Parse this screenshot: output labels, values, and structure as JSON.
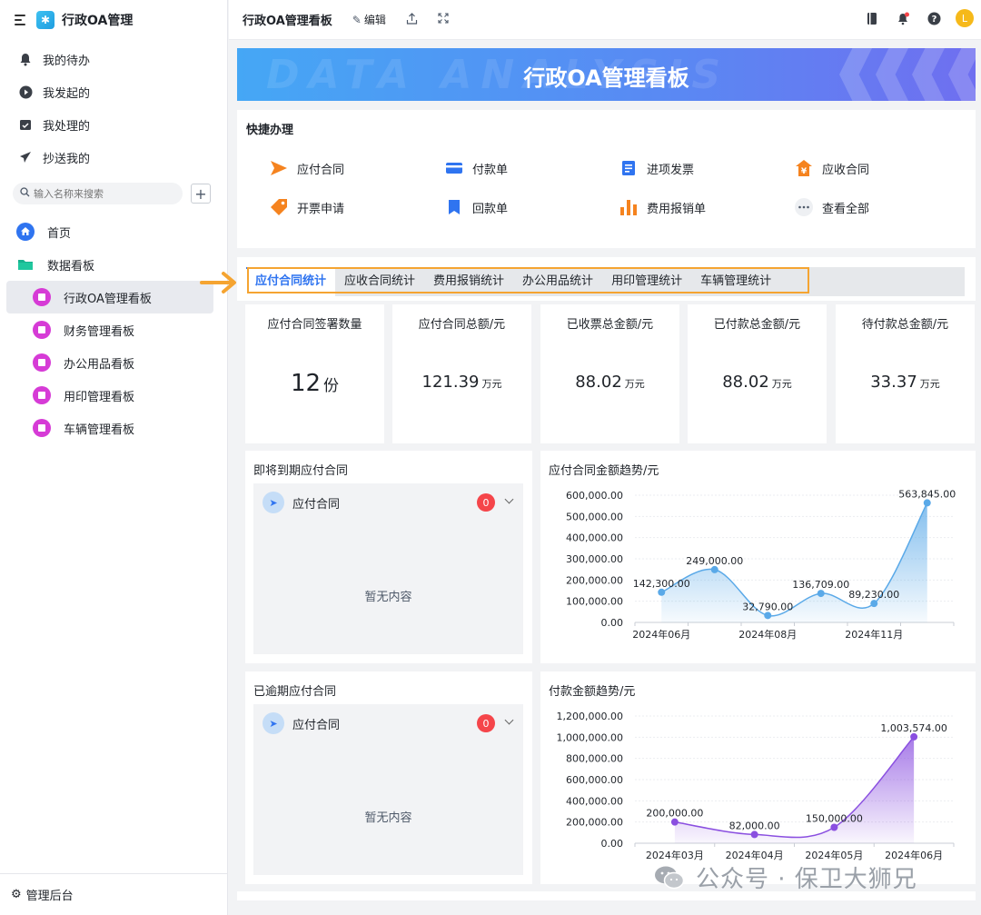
{
  "sidebar": {
    "app_title": "行政OA管理",
    "nav": [
      {
        "label": "我的待办",
        "icon": "bell-icon"
      },
      {
        "label": "我发起的",
        "icon": "play-circle-icon"
      },
      {
        "label": "我处理的",
        "icon": "calendar-check-icon"
      },
      {
        "label": "抄送我的",
        "icon": "send-icon"
      }
    ],
    "search_placeholder": "输入名称来搜索",
    "add_label": "+",
    "tree": [
      {
        "label": "首页",
        "icon": "home-icon"
      },
      {
        "label": "数据看板",
        "icon": "folder-icon"
      }
    ],
    "boards": [
      {
        "label": "行政OA管理看板",
        "icon": "dashboard-icon",
        "active": true
      },
      {
        "label": "财务管理看板",
        "icon": "finance-icon",
        "active": false
      },
      {
        "label": "办公用品看板",
        "icon": "box-icon",
        "active": false
      },
      {
        "label": "用印管理看板",
        "icon": "stamp-icon",
        "active": false
      },
      {
        "label": "车辆管理看板",
        "icon": "truck-icon",
        "active": false
      }
    ],
    "footer_label": "管理后台"
  },
  "topbar": {
    "title": "行政OA管理看板",
    "edit_label": "编辑",
    "avatar_letter": "L"
  },
  "banner": {
    "title": "行政OA管理看板",
    "bg_text": "DATA ANALYSIS"
  },
  "quick": {
    "title": "快捷办理",
    "items": [
      {
        "label": "应付合同",
        "icon": "send-icon",
        "color": "#f5831f"
      },
      {
        "label": "付款单",
        "icon": "card-icon",
        "color": "#2f74f0"
      },
      {
        "label": "进项发票",
        "icon": "document-icon",
        "color": "#2f74f0"
      },
      {
        "label": "应收合同",
        "icon": "yuan-house-icon",
        "color": "#f5831f"
      },
      {
        "label": "开票申请",
        "icon": "tag-icon",
        "color": "#f5831f"
      },
      {
        "label": "回款单",
        "icon": "bookmark-icon",
        "color": "#2f74f0"
      },
      {
        "label": "费用报销单",
        "icon": "bar-chart-icon",
        "color": "#f5831f"
      },
      {
        "label": "查看全部",
        "icon": "more-icon",
        "color": "#4e5969"
      }
    ]
  },
  "tabs": [
    {
      "label": "应付合同统计",
      "active": true
    },
    {
      "label": "应收合同统计",
      "active": false
    },
    {
      "label": "费用报销统计",
      "active": false
    },
    {
      "label": "办公用品统计",
      "active": false
    },
    {
      "label": "用印管理统计",
      "active": false
    },
    {
      "label": "车辆管理统计",
      "active": false
    }
  ],
  "stats": [
    {
      "label": "应付合同签署数量",
      "value": "12",
      "unit": "份"
    },
    {
      "label": "应付合同总额/元",
      "value": "121.39",
      "unit": "万元"
    },
    {
      "label": "已收票总金额/元",
      "value": "88.02",
      "unit": "万元"
    },
    {
      "label": "已付款总金额/元",
      "value": "88.02",
      "unit": "万元"
    },
    {
      "label": "待付款总金额/元",
      "value": "33.37",
      "unit": "万元"
    }
  ],
  "expiring": {
    "title": "即将到期应付合同",
    "row_label": "应付合同",
    "badge": "0",
    "empty_text": "暂无内容"
  },
  "overdue": {
    "title": "已逾期应付合同",
    "row_label": "应付合同",
    "badge": "0",
    "empty_text": "暂无内容"
  },
  "watermark": "公众号 · 保卫大狮兄",
  "chart_data": [
    {
      "type": "area",
      "title": "应付合同金额趋势/元",
      "x": [
        "2024年06月",
        "2024年07月",
        "2024年08月",
        "2024年09月",
        "2024年11月",
        "2024年12月"
      ],
      "xtick_labels": [
        "2024年06月",
        "2024年08月",
        "2024年11月"
      ],
      "values": [
        142300,
        249000,
        32790,
        136709,
        89230,
        563845
      ],
      "data_labels": [
        "142,300.00",
        "249,000.00",
        "32,790.00",
        "136,709.00",
        "89,230.00",
        "563,845.00"
      ],
      "yticks": [
        "0.00",
        "100,000.00",
        "200,000.00",
        "300,000.00",
        "400,000.00",
        "500,000.00",
        "600,000.00"
      ],
      "ylim": [
        0,
        600000
      ],
      "color": "#5aa9e8",
      "grid": true
    },
    {
      "type": "area",
      "title": "付款金额趋势/元",
      "x": [
        "2024年03月",
        "2024年04月",
        "2024年05月",
        "2024年06月"
      ],
      "xtick_labels": [
        "2024年03月",
        "2024年04月",
        "2024年05月",
        "2024年06月"
      ],
      "values": [
        200000,
        82000,
        150000,
        1003574
      ],
      "data_labels": [
        "200,000.00",
        "82,000.00",
        "150,000.00",
        "1,003,574.00"
      ],
      "yticks": [
        "0.00",
        "200,000.00",
        "400,000.00",
        "600,000.00",
        "800,000.00",
        "1,000,000.00",
        "1,200,000.00"
      ],
      "ylim": [
        0,
        1200000
      ],
      "color": "#8a4fe0",
      "grid": true
    }
  ]
}
